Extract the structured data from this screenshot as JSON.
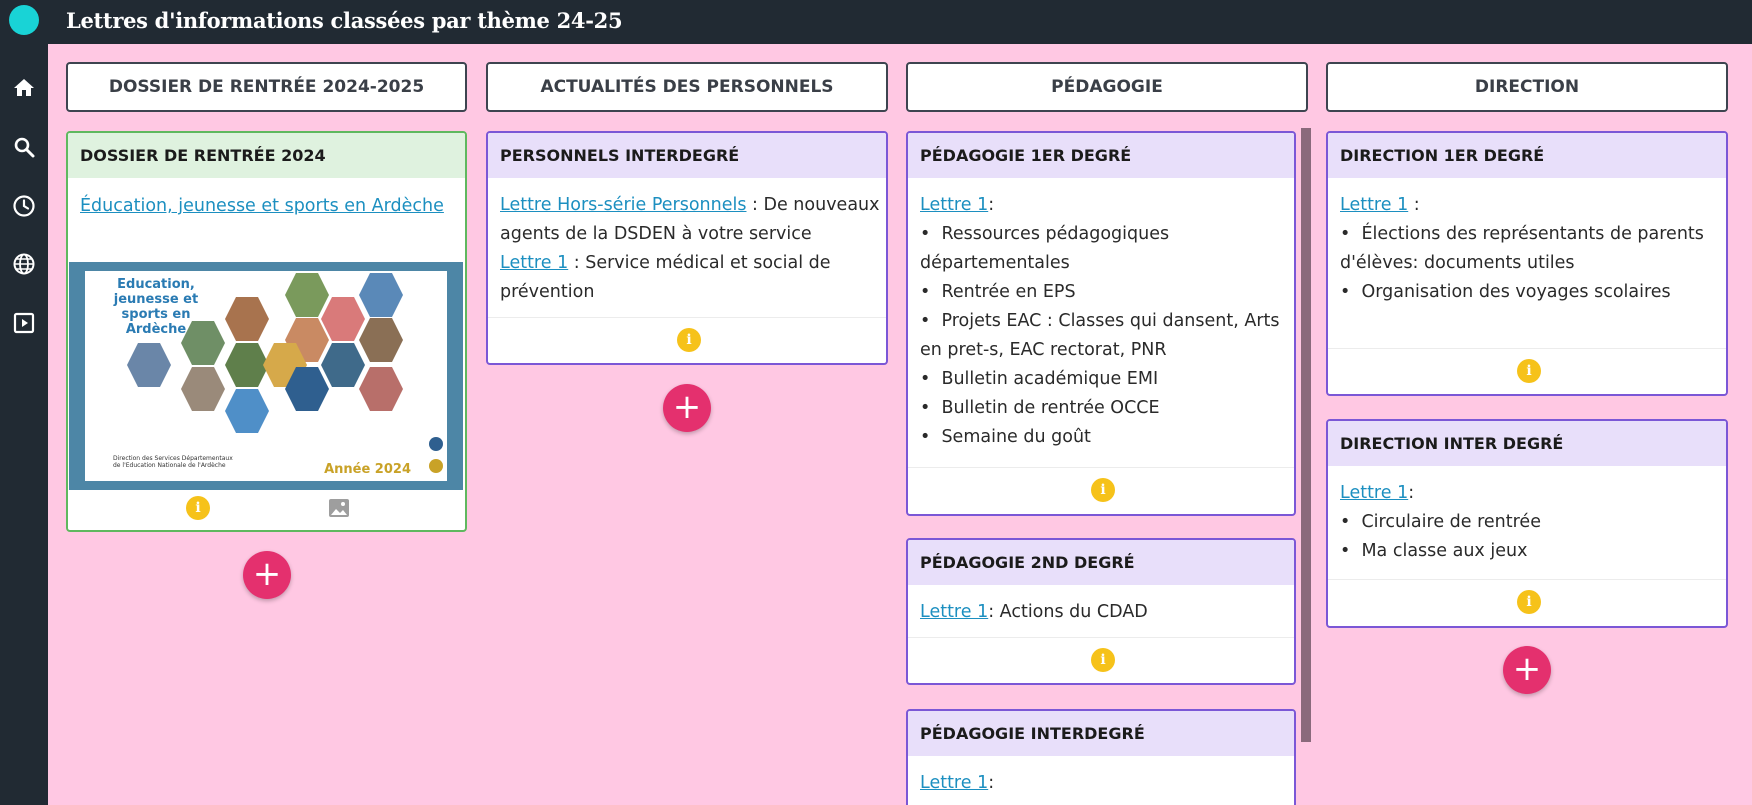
{
  "app": {
    "title": "Lettres d'informations classées par thème 24-25"
  },
  "sidebar": {
    "icons": [
      "home-icon",
      "search-icon",
      "clock-icon",
      "globe-icon",
      "slideshow-icon"
    ]
  },
  "columns": [
    {
      "header": "DOSSIER DE RENTRÉE 2024-2025"
    },
    {
      "header": "ACTUALITÉS DES PERSONNELS"
    },
    {
      "header": "PÉDAGOGIE"
    },
    {
      "header": "DIRECTION"
    }
  ],
  "cards": {
    "dossier": {
      "title": "DOSSIER DE RENTRÉE 2024",
      "link": "Éducation, jeunesse et sports en Ardèche",
      "thumb_title": "Education, jeunesse et sports en Ardèche",
      "thumb_year": "Année 2024",
      "thumb_org": "Direction des Services Départementaux de l'Education Nationale de l'Ardèche"
    },
    "personnels": {
      "title": "PERSONNELS INTERDEGRÉ",
      "link1": "Lettre Hors-série Personnels",
      "text1": " : De nouveaux",
      "text1b": "agents de la DSDEN à votre service",
      "link2": "Lettre 1",
      "text2": " : Service médical et social de",
      "text2b": "prévention"
    },
    "peda1": {
      "title": "PÉDAGOGIE 1ER DEGRÉ",
      "link": "Lettre 1",
      "after": ":",
      "bullets": [
        "Ressources pédagogiques",
        "Rentrée en EPS",
        "Projets EAC : Classes qui dansent, Arts",
        "Bulletin académique EMI",
        "Bulletin de rentrée OCCE",
        "Semaine du goût"
      ],
      "wrap1": "départementales",
      "wrap3": "en pret-s, EAC rectorat, PNR"
    },
    "peda2": {
      "title": "PÉDAGOGIE 2ND DEGRÉ",
      "link": "Lettre 1",
      "after": ": Actions du CDAD"
    },
    "pedaInter": {
      "title": "PÉDAGOGIE INTERDEGRÉ",
      "link": "Lettre 1",
      "after": ":"
    },
    "dir1": {
      "title": "DIRECTION 1ER DEGRÉ",
      "link": "Lettre 1",
      "after": " :",
      "bullet1": "Élections des représentants de parents",
      "bullet1b": "d'élèves: documents utiles",
      "bullet2": "Organisation des voyages scolaires"
    },
    "dirInter": {
      "title": "DIRECTION INTER DEGRÉ",
      "link": "Lettre 1",
      "after": ":",
      "bullets": [
        "Circulaire de rentrée",
        "Ma classe aux jeux"
      ]
    }
  },
  "info_glyph": "i",
  "add_glyph": "+",
  "colors": {
    "background": "#ffc8e3",
    "topbar": "#212a33",
    "accent": "#e4306e",
    "link": "#1c8fc0"
  }
}
